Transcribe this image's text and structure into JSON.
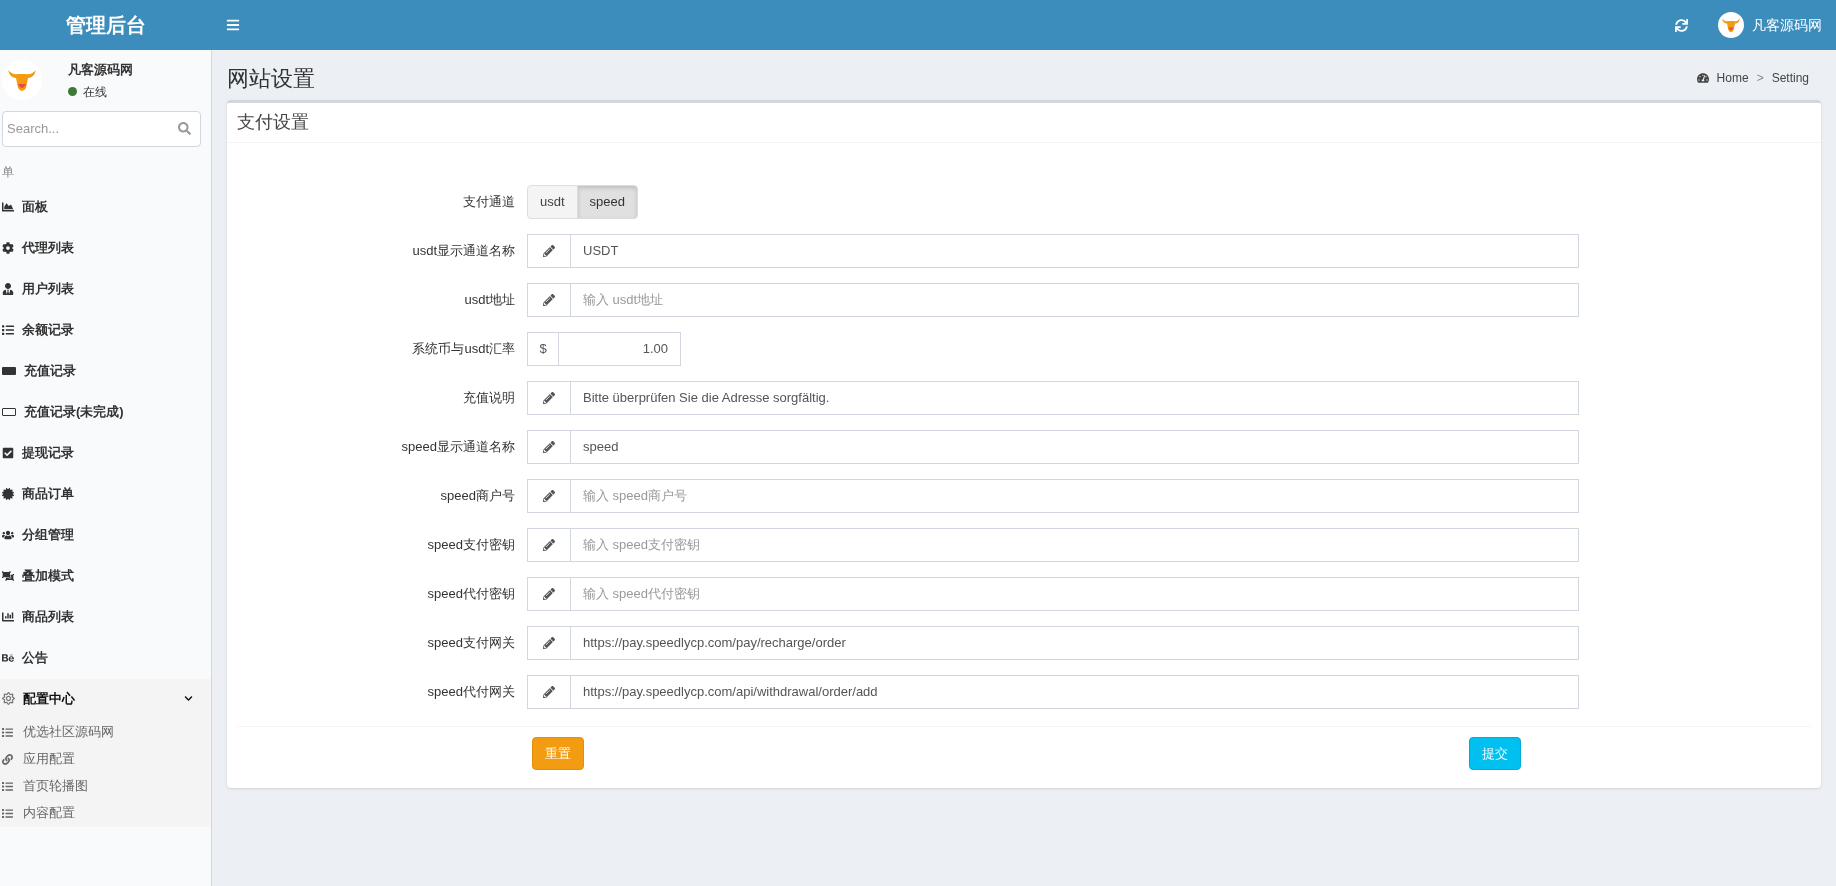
{
  "header": {
    "brand": "管理后台",
    "user_name": "凡客源码网"
  },
  "sidebar": {
    "user": {
      "name": "凡客源码网",
      "status": "在线",
      "online": true
    },
    "search": {
      "placeholder": "Search..."
    },
    "menu_title": "单",
    "items": [
      {
        "label": "面板"
      },
      {
        "label": "代理列表"
      },
      {
        "label": "用户列表"
      },
      {
        "label": "余额记录"
      },
      {
        "label": "充值记录"
      },
      {
        "label": "充值记录(未完成)"
      },
      {
        "label": "提现记录"
      },
      {
        "label": "商品订单"
      },
      {
        "label": "分组管理"
      },
      {
        "label": "叠加模式"
      },
      {
        "label": "商品列表"
      },
      {
        "label": "公告"
      }
    ],
    "group": {
      "label": "配置中心",
      "expanded": true,
      "children": [
        {
          "label": "优选社区源码网"
        },
        {
          "label": "应用配置"
        },
        {
          "label": "首页轮播图"
        },
        {
          "label": "内容配置"
        }
      ]
    }
  },
  "page": {
    "title": "网站设置",
    "breadcrumb": [
      "Home",
      "Setting"
    ],
    "breadcrumb_separator": ">"
  },
  "card": {
    "title": "支付设置",
    "rows": [
      {
        "kind": "toggle",
        "label": "支付通道",
        "options": [
          {
            "label": "usdt",
            "selected": false
          },
          {
            "label": "speed",
            "selected": true
          }
        ]
      },
      {
        "kind": "text",
        "label": "usdt显示通道名称",
        "value": "USDT"
      },
      {
        "kind": "text",
        "label": "usdt地址",
        "placeholder": "输入 usdt地址"
      },
      {
        "kind": "currency",
        "label": "系统币与usdt汇率",
        "prefix": "$",
        "value": "1.00"
      },
      {
        "kind": "text",
        "label": "充值说明",
        "value": "Bitte überprüfen Sie die Adresse sorgfältig."
      },
      {
        "kind": "text",
        "label": "speed显示通道名称",
        "value": "speed"
      },
      {
        "kind": "text",
        "label": "speed商户号",
        "placeholder": "输入 speed商户号"
      },
      {
        "kind": "text",
        "label": "speed支付密钥",
        "placeholder": "输入 speed支付密钥"
      },
      {
        "kind": "text",
        "label": "speed代付密钥",
        "placeholder": "输入 speed代付密钥"
      },
      {
        "kind": "text",
        "label": "speed支付网关",
        "value": "https://pay.speedlycp.com/pay/recharge/order"
      },
      {
        "kind": "text",
        "label": "speed代付网关",
        "value": "https://pay.speedlycp.com/api/withdrawal/order/add"
      }
    ],
    "reset_button": "重置",
    "submit_button": "提交"
  }
}
